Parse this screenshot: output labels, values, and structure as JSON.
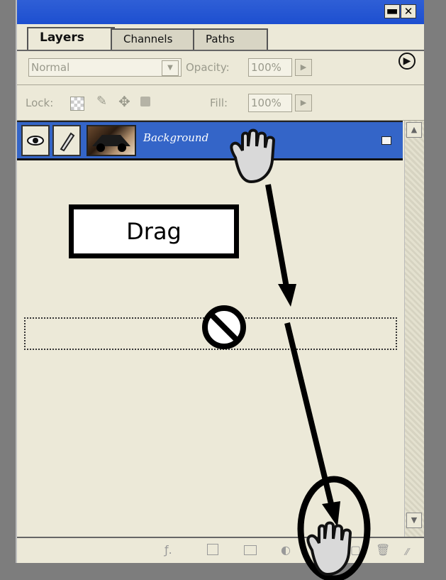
{
  "tabs": [
    {
      "label": "Layers",
      "active": true
    },
    {
      "label": "Channels",
      "active": false
    },
    {
      "label": "Paths",
      "active": false
    }
  ],
  "blend_mode": "Normal",
  "opacity_label": "Opacity:",
  "opacity_value": "100%",
  "lock_label": "Lock:",
  "fill_label": "Fill:",
  "fill_value": "100%",
  "layer": {
    "name": "Background",
    "visible": true,
    "locked": true
  },
  "annotation": {
    "label": "Drag"
  },
  "icons": {
    "minimize": "minimize-icon",
    "close": "close-icon",
    "panel_menu": "play-circle-icon",
    "eye": "eye-icon",
    "brush": "brush-icon",
    "lock": "lock-icon",
    "hand": "hand-cursor-icon",
    "no": "no-drop-icon"
  },
  "colors": {
    "title_bar": "#1d4fd0",
    "selected_layer": "#3465c8",
    "panel": "#ece9d8"
  }
}
